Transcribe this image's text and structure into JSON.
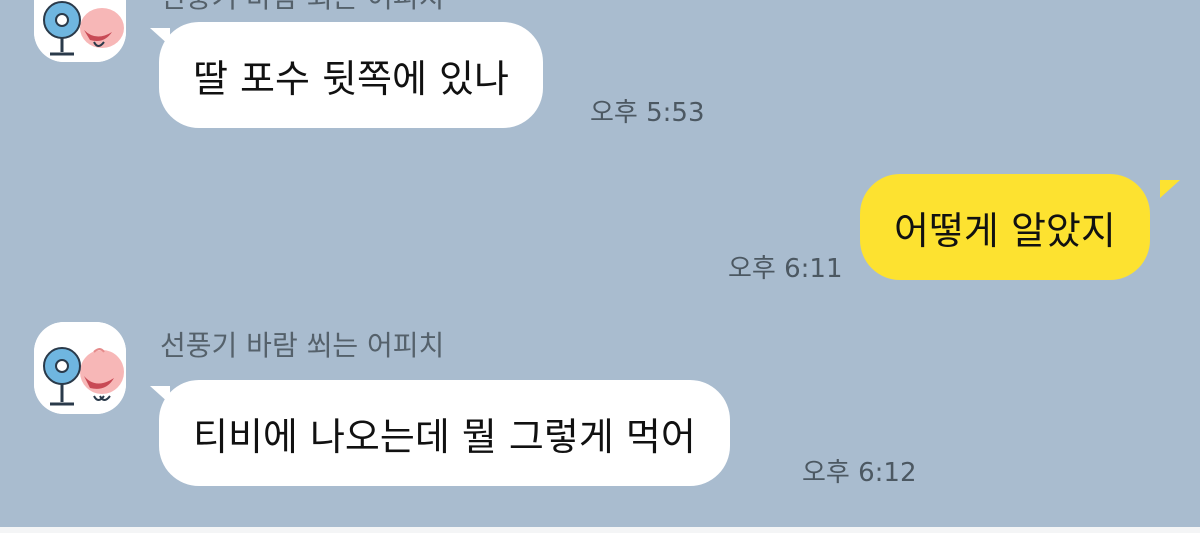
{
  "chat": {
    "partial_sender_name": "선풍기 바람 쐬는 어피치",
    "messages": [
      {
        "direction": "incoming",
        "text": "딸 포수 뒷쪽에 있나",
        "time": "오후 5:53"
      },
      {
        "direction": "outgoing",
        "text": "어떻게 알았지",
        "time": "오후 6:11"
      },
      {
        "direction": "incoming",
        "sender": "선풍기 바람 쐬는 어피치",
        "text": "티비에 나오는데 뭘 그렇게 먹어",
        "time": "오후 6:12"
      }
    ]
  },
  "colors": {
    "background": "#a9bccf",
    "incoming_bubble": "#ffffff",
    "outgoing_bubble": "#fde230"
  },
  "icons": {
    "avatar": "apeach-with-fan-avatar"
  }
}
